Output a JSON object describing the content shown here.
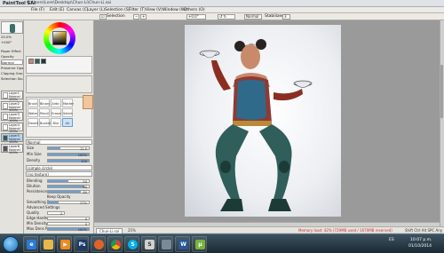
{
  "window": {
    "app_logo": "PaintTool SAI",
    "title_path": "C:\\Users\\Lore\\Desktop\\Chun-Li\\Chun-Li.sai"
  },
  "menu": [
    "File (F)",
    "Edit (E)",
    "Canvas (C)",
    "Layer (L)",
    "Selection (S)",
    "Filter (T)",
    "View (V)",
    "Window (W)",
    "Others (O)"
  ],
  "toolbar": {
    "selection_label": "Selection",
    "zoom_value": "+0.0°",
    "mode_value": "Normal",
    "stabilizer_label": "Stabilizer",
    "stabilizer_value": "3"
  },
  "left_panel": {
    "zoom": "25.0%",
    "angle": "+000°",
    "paper_effect": "Paper Effect",
    "opacity_label": "Opacity",
    "mode": "Normal",
    "preserve_opacity": "Preserve Opacity",
    "clipping_group": "Clipping Group",
    "selection_source": "Selection Source",
    "layers": [
      {
        "name": "Layer1",
        "mode": "Normal",
        "opacity": "100%"
      },
      {
        "name": "Layer2",
        "mode": "Normal",
        "opacity": "100%"
      },
      {
        "name": "Layer3",
        "mode": "Normal",
        "opacity": "100%"
      },
      {
        "name": "Layer4",
        "mode": "Normal",
        "opacity": "100%"
      },
      {
        "name": "Layer5",
        "mode": "Normal",
        "opacity": "100%"
      },
      {
        "name": "Layer6",
        "mode": "Normal",
        "opacity": "100%"
      }
    ]
  },
  "tools": [
    "Brush",
    "Binary",
    "Airbr.",
    "Marker",
    "Water",
    "Pencil",
    "Eraser",
    "Select",
    "Deselt",
    "Bucket",
    "Blur",
    "Air"
  ],
  "brush_props": {
    "mode": "Normal",
    "size_label": "Size",
    "size_value": "12.0",
    "min_size_label": "Min Size",
    "min_size_value": "100%",
    "density_label": "Density",
    "density_value": "100",
    "shape_label": "(simple circle)",
    "texture_label": "(no texture)",
    "blending_label": "Blending",
    "blending_value": "50",
    "dilution_label": "Dilution",
    "dilution_value": "90",
    "persistence_label": "Persistence",
    "persistence_value": "80",
    "keep_opacity": "Keep Opacity",
    "smoothing_label": "Smoothing Pre",
    "smoothing_value": "27%",
    "advanced": "Advanced Settings",
    "quality_label": "Quality",
    "quality_value": "2",
    "edge_label": "Edge Hardness",
    "edge_value": "0",
    "min_density_label": "Min Density",
    "min_density_value": "0",
    "max_dens_label": "Max Dens Pre",
    "max_dens_value": "100%"
  },
  "status": {
    "file_tab": "Chun-Li.sai",
    "zoom_tab": "25%",
    "memory": "Memory load: 42% (729MB used / 1670MB reserved)",
    "keys": "Shift Ctrl Alt SPC Any"
  },
  "taskbar": {
    "apps": [
      "ie",
      "folder",
      "media",
      "photoshop",
      "firefox",
      "chrome",
      "skype",
      "sai",
      "calc",
      "word",
      "torrent"
    ],
    "time": "10:07 p.m.",
    "date": "01/10/2014",
    "language": "ES"
  },
  "colors": {
    "accent_blue": "#6f9fd3",
    "workspace_gray": "#9a9a9a",
    "outfit_teal": "#2f5e5b",
    "skin": "#c98a6c",
    "boots": "#1d3b36"
  }
}
